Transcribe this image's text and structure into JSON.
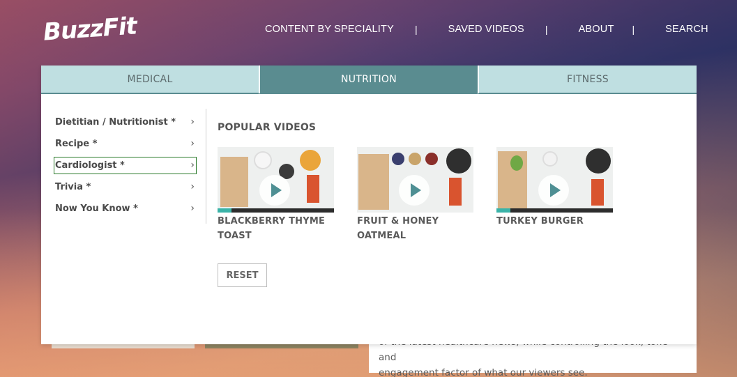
{
  "header": {
    "logo_text": "BuzzFit",
    "nav": [
      {
        "label": "CONTENT BY SPECIALITY"
      },
      {
        "label": "SAVED VIDEOS"
      },
      {
        "label": "ABOUT"
      },
      {
        "label": "SEARCH"
      }
    ],
    "separator": "|"
  },
  "tabs": [
    {
      "label": "MEDICAL",
      "active": false
    },
    {
      "label": "NUTRITION",
      "active": true
    },
    {
      "label": "FITNESS",
      "active": false
    }
  ],
  "menu": [
    {
      "label": "Dietitian / Nutritionist *"
    },
    {
      "label": "Recipe *"
    },
    {
      "label": "Cardiologist *",
      "focused": true
    },
    {
      "label": "Trivia *"
    },
    {
      "label": "Now You Know *"
    }
  ],
  "chevron": "›",
  "popular": {
    "title": "POPULAR VIDEOS",
    "videos": [
      {
        "title": "BLACKBERRY THYME TOAST"
      },
      {
        "title": "FRUIT & HONEY OATMEAL"
      },
      {
        "title": "TURKEY BURGER"
      }
    ]
  },
  "reset_label": "RESET",
  "background_text": {
    "line1": "of the latest healthcare news, while controlling the look, tone and",
    "line2": "engagement factor of what our viewers see."
  },
  "colors": {
    "accent": "#5a8c90",
    "tab_inactive": "#bfdfe1"
  }
}
